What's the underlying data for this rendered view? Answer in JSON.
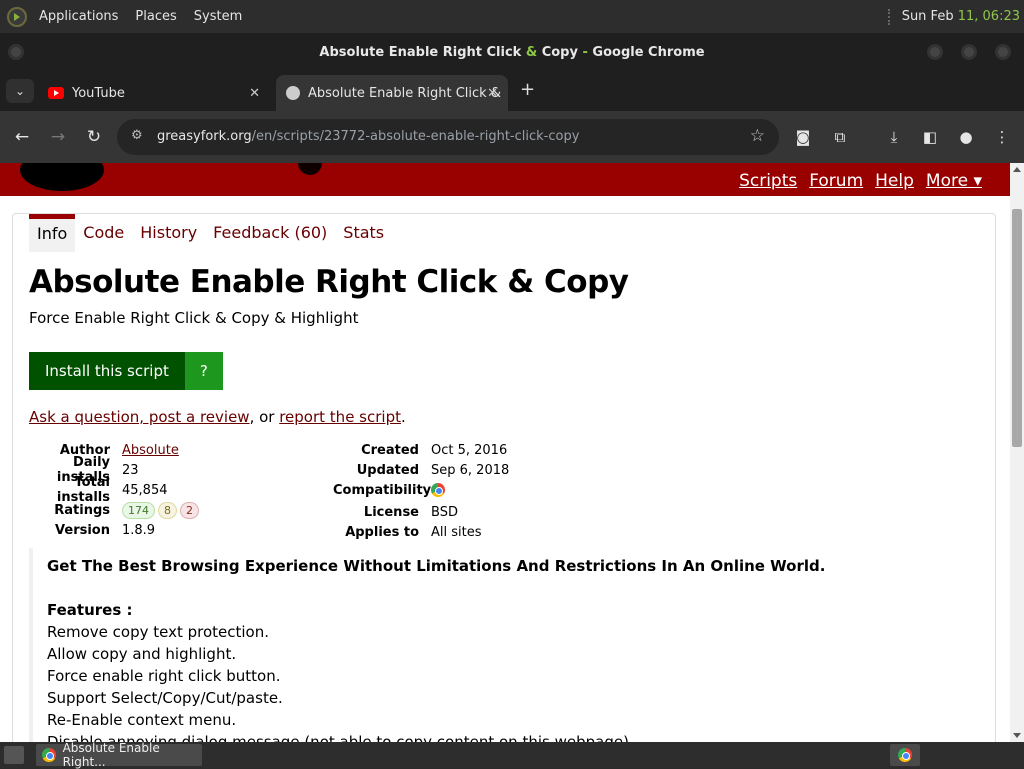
{
  "desktop_panel": {
    "menus": [
      "Applications",
      "Places",
      "System"
    ],
    "clock_date": "Sun Feb",
    "clock_time": "11, 06:23"
  },
  "window": {
    "title_prefix": "Absolute Enable Right Click ",
    "title_amp": "&",
    "title_suffix": " Copy",
    "title_dash": " - ",
    "title_app": "Google Chrome"
  },
  "tabs": [
    {
      "title": "YouTube",
      "close": "✕"
    },
    {
      "title": "Absolute Enable Right Click &",
      "close": "✕"
    }
  ],
  "toolbar": {
    "url_host": "greasyfork.org",
    "url_path": "/en/scripts/23772-absolute-enable-right-click-copy"
  },
  "site_nav": [
    "Scripts",
    "Forum",
    "Help",
    "More ▾"
  ],
  "script_tabs": [
    "Info",
    "Code",
    "History",
    "Feedback (60)",
    "Stats"
  ],
  "script": {
    "title": "Absolute Enable Right Click & Copy",
    "description": "Force Enable Right Click & Copy & Highlight",
    "install_label": "Install this script",
    "install_help": "?",
    "ask_link": "Ask a question, post a review",
    "ask_sep": ", or ",
    "report_link": "report the script",
    "ask_end": "."
  },
  "meta_left": {
    "author_label": "Author",
    "author": "Absolute",
    "daily_label": "Daily installs",
    "daily": "23",
    "total_label": "Total installs",
    "total": "45,854",
    "ratings_label": "Ratings",
    "ratings_good": "174",
    "ratings_ok": "8",
    "ratings_bad": "2",
    "version_label": "Version",
    "version": "1.8.9"
  },
  "meta_right": {
    "created_label": "Created",
    "created": "Oct 5, 2016",
    "updated_label": "Updated",
    "updated": "Sep 6, 2018",
    "compat_label": "Compatibility",
    "compat_icon": "chrome-icon",
    "license_label": "License",
    "license": "BSD",
    "applies_label": "Applies to",
    "applies": "All sites"
  },
  "additional": {
    "lead": "Get The Best Browsing Experience Without Limitations And Restrictions In An Online World.",
    "features_heading": "Features :",
    "features": [
      "Remove copy text protection.",
      "Allow copy and highlight.",
      "Force enable right click button.",
      "Support Select/Copy/Cut/paste.",
      "Re-Enable context menu.",
      "Disable annoying dialog message (not able to copy content on this webpage)."
    ]
  },
  "taskbar": {
    "task_label": "Absolute Enable Right..."
  },
  "colors": {
    "site_header": "#990000",
    "install_button": "#005200",
    "install_help": "#1e971e",
    "clock_time": "#8ec74a"
  }
}
